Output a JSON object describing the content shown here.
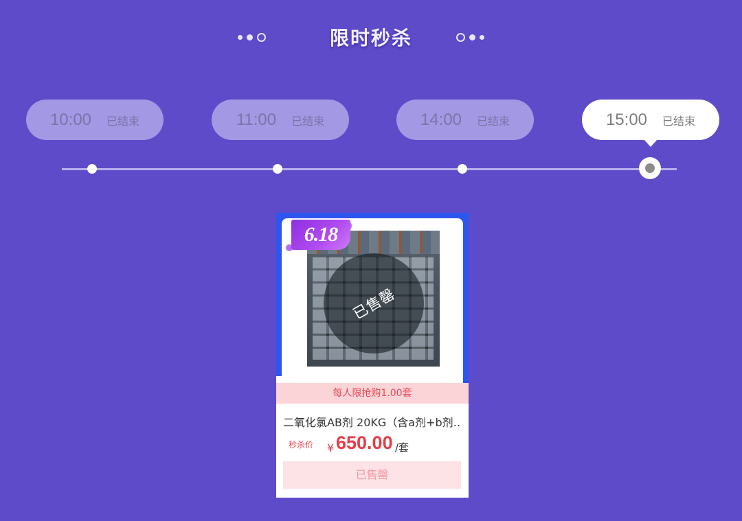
{
  "header": {
    "title": "限时秒杀"
  },
  "time_slots": [
    {
      "time": "10:00",
      "status": "已结束",
      "active": false
    },
    {
      "time": "11:00",
      "status": "已结束",
      "active": false
    },
    {
      "time": "14:00",
      "status": "已结束",
      "active": false
    },
    {
      "time": "15:00",
      "status": "已结束",
      "active": true
    }
  ],
  "product": {
    "badge": "6.18",
    "overlay_text": "已售罄",
    "limit_text": "每人限抢购1.00套",
    "name": "二氧化氯AB剂 20KG（含a剂+b剂…",
    "price_label": "秒杀价",
    "currency": "¥",
    "price": "650.00",
    "unit": "/套",
    "button_label": "已售罄"
  },
  "colors": {
    "background": "#5d4bca",
    "slot_inactive": "#a398e4",
    "slot_active": "#ffffff",
    "card_accent": "#2d55f0",
    "price_red": "#e53d47",
    "limit_bar": "#fbd4d8"
  },
  "icons": [
    "decorative-dots-icon",
    "timeline-node-icon",
    "badge-618-icon"
  ]
}
